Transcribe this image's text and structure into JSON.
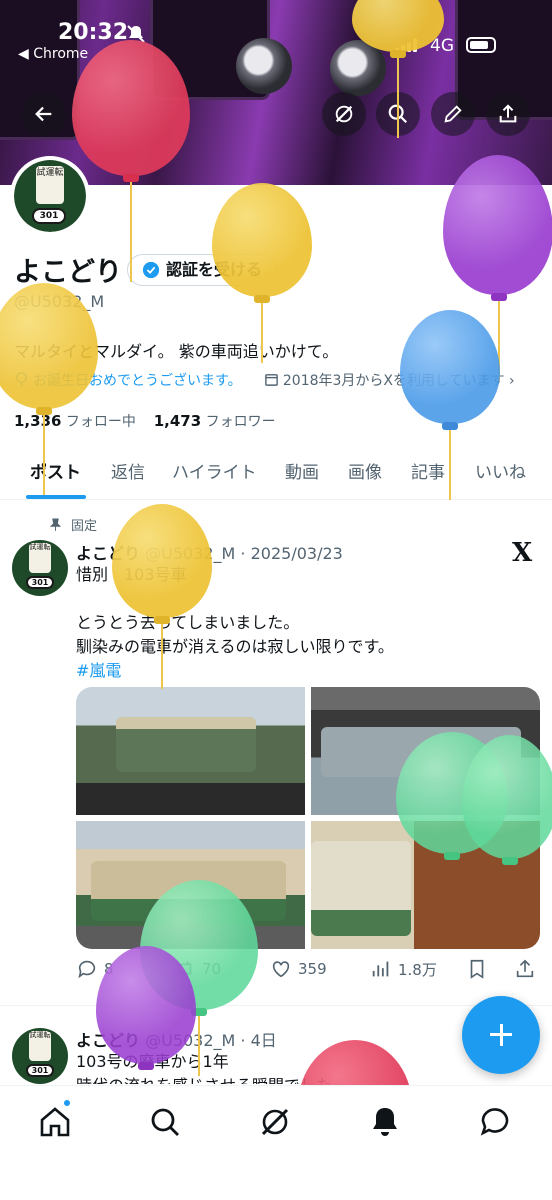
{
  "status_bar": {
    "time": "20:32",
    "back_app": "◀ Chrome",
    "carrier": "4G"
  },
  "profile": {
    "display_name": "よこどり",
    "verify_button": "認証を受ける",
    "handle": "@U5032_M",
    "bio": "マルタイとマルダイ。 紫の車両追いかけて。",
    "birthday_text": "お誕生日おめでとうございます。",
    "joined_text": "2018年3月からXを利用しています",
    "following_count": "1,336",
    "following_label": "フォロー中",
    "followers_count": "1,473",
    "followers_label": "フォロワー",
    "avatar_plate": "301",
    "avatar_emblem": "試運転"
  },
  "tabs": [
    "ポスト",
    "返信",
    "ハイライト",
    "動画",
    "画像",
    "記事",
    "いいね"
  ],
  "posts": [
    {
      "pinned_label": "固定",
      "name": "よこどり",
      "handle_date": "@U5032_M · 2025/03/23",
      "line1": "惜別　103号車",
      "line2": "とうとう去ってしまいました。",
      "line3": "馴染みの電車が消えるのは寂しい限りです。",
      "hashtag": "#嵐電",
      "replies": "8",
      "reposts": "70",
      "likes": "359",
      "views": "1.8万"
    },
    {
      "name": "よこどり",
      "handle_date": "@U5032_M · 4日",
      "line1": "103号の廃車から1年",
      "line2": "時代の流れを感じさせる瞬間でした"
    }
  ],
  "colors": {
    "accent": "#1d9bf0",
    "text": "#0f1419",
    "muted": "#536471",
    "banner": "#6b2a8c"
  },
  "icons": [
    "back-arrow-icon",
    "grok-icon",
    "search-icon",
    "edit-icon",
    "share-icon",
    "verified-check-icon",
    "balloon-icon",
    "calendar-icon",
    "pin-icon",
    "x-logo-icon",
    "reply-icon",
    "repost-icon",
    "like-icon",
    "views-icon",
    "bookmark-icon",
    "home-icon",
    "explore-icon",
    "notifications-icon",
    "messages-icon",
    "compose-icon"
  ]
}
